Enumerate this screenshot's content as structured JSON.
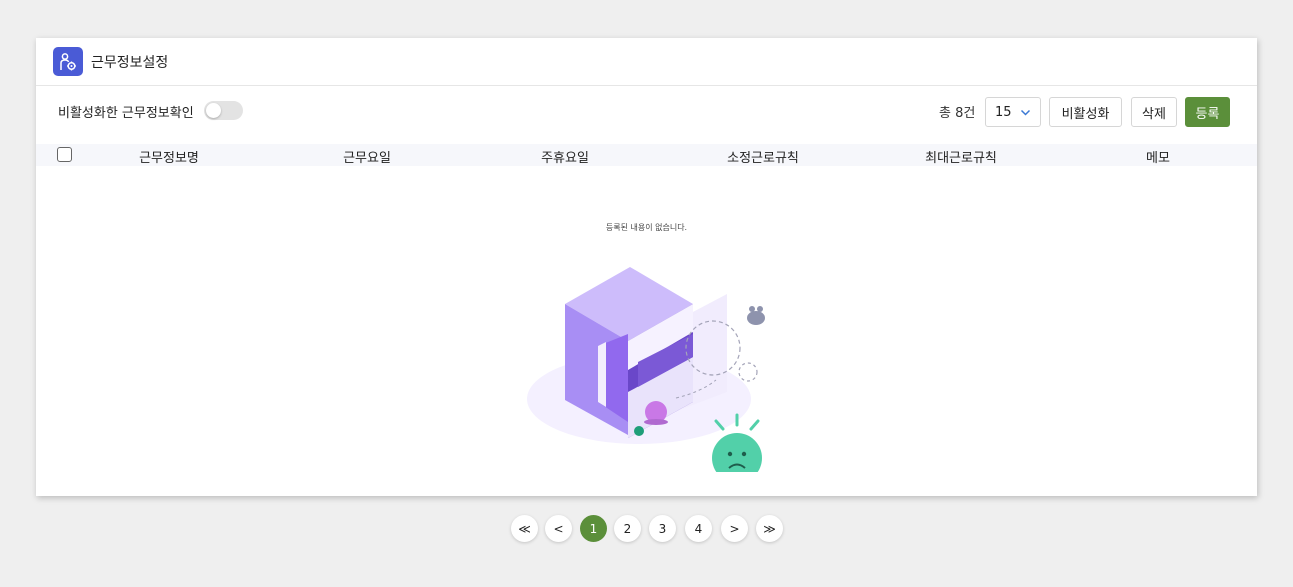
{
  "header": {
    "title": "근무정보설정",
    "icon": "user-gear-icon"
  },
  "toolbar": {
    "toggle_label": "비활성화한 근무정보확인",
    "toggle_on": false,
    "total": "총 8건",
    "page_size": "15",
    "deactivate_label": "비활성화",
    "delete_label": "삭제",
    "register_label": "등록"
  },
  "table": {
    "columns": [
      "근무정보명",
      "근무요일",
      "주휴요일",
      "소정근로규칙",
      "최대근로규칙",
      "메모"
    ],
    "rows": [],
    "empty_message": "등록된 내용이 없습니다."
  },
  "pagination": {
    "first": "≪",
    "prev": "<",
    "pages": [
      "1",
      "2",
      "3",
      "4"
    ],
    "current": "1",
    "next": ">",
    "last": "≫"
  },
  "colors": {
    "accent": "#5b8f3a",
    "icon_bg": "#4a5bd6"
  }
}
